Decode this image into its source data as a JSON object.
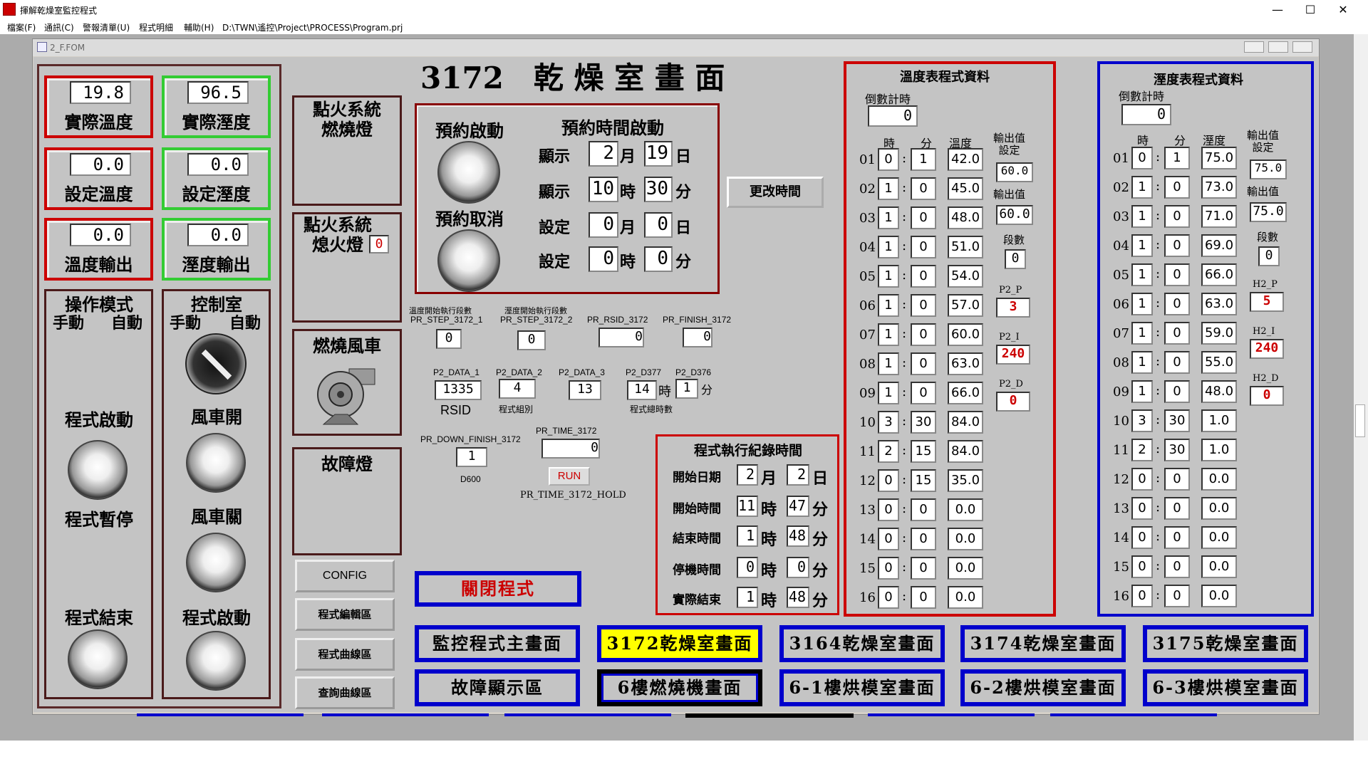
{
  "window": {
    "title": "揮解乾燥室監控程式",
    "min": "—",
    "max": "☐",
    "close": "✕"
  },
  "menu": [
    "檔案(F)",
    "通訊(C)",
    "警報清單(U)",
    "程式明細",
    "輔助(H)",
    "D:\\TWN\\遙控\\Project\\PROCESS\\Program.prj"
  ],
  "child": {
    "title": "2_F.FOM"
  },
  "page_title": "3172　乾 燥 室 畫 面",
  "readouts": [
    {
      "value": "19.8",
      "label": "實際溫度",
      "color": "red"
    },
    {
      "value": "96.5",
      "label": "實際溼度",
      "color": "green"
    },
    {
      "value": "0.0",
      "label": "設定溫度",
      "color": "red"
    },
    {
      "value": "0.0",
      "label": "設定溼度",
      "color": "green"
    },
    {
      "value": "0.0",
      "label": "溫度輸出",
      "color": "red"
    },
    {
      "value": "0.0",
      "label": "溼度輸出",
      "color": "green"
    }
  ],
  "mode_panel": {
    "title": "操作模式",
    "manual": "手動",
    "auto": "自動",
    "start": "程式啟動",
    "pause": "程式暫停",
    "end": "程式結束"
  },
  "control_panel": {
    "title": "控制室",
    "manual": "手動",
    "auto": "自動",
    "fan_on": "風車開",
    "fan_off": "風車關",
    "start": "程式啟動"
  },
  "ignition_burn": "點火系統\n燃燒燈",
  "ignition_off": {
    "label": "點火系統\n熄火燈",
    "value": "0"
  },
  "burner_fan": "燃燒風車",
  "fault_lamp": "故障燈",
  "config": "CONFIG",
  "prog_edit": "程式編輯區",
  "prog_curve": "程式曲線區",
  "query_curve": "查詢曲線區",
  "schedule": {
    "start_label": "預約啟動",
    "cancel_label": "預約取消",
    "title": "預約時間啟動",
    "rows": [
      {
        "prefix": "顯示",
        "a": "2",
        "ua": "月",
        "b": "19",
        "ub": "日"
      },
      {
        "prefix": "顯示",
        "a": "10",
        "ua": "時",
        "b": "30",
        "ub": "分"
      },
      {
        "prefix": "設定",
        "a": "0",
        "ua": "月",
        "b": "0",
        "ub": "日"
      },
      {
        "prefix": "設定",
        "a": "0",
        "ua": "時",
        "b": "0",
        "ub": "分"
      }
    ]
  },
  "change_time": "更改時間",
  "vars": {
    "step1_cn": "溫度開始執行段數",
    "step1": "PR_STEP_3172_1",
    "step1_v": "0",
    "step2_cn": "溼度開始執行段數",
    "step2": "PR_STEP_3172_2",
    "step2_v": "0",
    "rsid": "PR_RSID_3172",
    "rsid_v": "0",
    "finish": "PR_FINISH_3172",
    "finish_v": "0",
    "d1": "P2_DATA_1",
    "d1_v": "1335",
    "d1_sub": "RSID",
    "d2": "P2_DATA_2",
    "d2_v": "4",
    "d2_sub": "程式組別",
    "d3": "P2_DATA_3",
    "d3_v": "13",
    "d377": "P2_D377",
    "d377_v": "14",
    "d377_u": "時",
    "d376": "P2_D376",
    "d376_v": "1",
    "d376_u": "分",
    "total": "程式總時數",
    "down": "PR_DOWN_FINISH_3172",
    "down_v": "1",
    "down_sub": "D600",
    "time": "PR_TIME_3172",
    "time_v": "0",
    "run": "RUN",
    "hold": "PR_TIME_3172_HOLD"
  },
  "log": {
    "title": "程式執行紀錄時間",
    "rows": [
      {
        "label": "開始日期",
        "a": "2",
        "ua": "月",
        "b": "2",
        "ub": "日"
      },
      {
        "label": "開始時間",
        "a": "11",
        "ua": "時",
        "b": "47",
        "ub": "分"
      },
      {
        "label": "結束時間",
        "a": "1",
        "ua": "時",
        "b": "48",
        "ub": "分"
      },
      {
        "label": "停機時間",
        "a": "0",
        "ua": "時",
        "b": "0",
        "ub": "分"
      },
      {
        "label": "實際結束",
        "a": "1",
        "ua": "時",
        "b": "48",
        "ub": "分"
      }
    ]
  },
  "close_prog": "關閉程式",
  "temp_table": {
    "title": "溫度表程式資料",
    "countdown": "倒數計時",
    "countdown_v": "0",
    "h_hour": "時",
    "h_min": "分",
    "h_val": "溫度",
    "out_set": "輸出值\n設定",
    "out_set_v": "60.0",
    "out": "輸出值",
    "out_v": "60.0",
    "seg": "段數",
    "seg_v": "0",
    "p": "P2_P",
    "p_v": "3",
    "i": "P2_I",
    "i_v": "240",
    "d": "P2_D",
    "d_v": "0",
    "rows": [
      [
        "01",
        "0",
        "1",
        "42.0"
      ],
      [
        "02",
        "1",
        "0",
        "45.0"
      ],
      [
        "03",
        "1",
        "0",
        "48.0"
      ],
      [
        "04",
        "1",
        "0",
        "51.0"
      ],
      [
        "05",
        "1",
        "0",
        "54.0"
      ],
      [
        "06",
        "1",
        "0",
        "57.0"
      ],
      [
        "07",
        "1",
        "0",
        "60.0"
      ],
      [
        "08",
        "1",
        "0",
        "63.0"
      ],
      [
        "09",
        "1",
        "0",
        "66.0"
      ],
      [
        "10",
        "3",
        "30",
        "84.0"
      ],
      [
        "11",
        "2",
        "15",
        "84.0"
      ],
      [
        "12",
        "0",
        "15",
        "35.0"
      ],
      [
        "13",
        "0",
        "0",
        "0.0"
      ],
      [
        "14",
        "0",
        "0",
        "0.0"
      ],
      [
        "15",
        "0",
        "0",
        "0.0"
      ],
      [
        "16",
        "0",
        "0",
        "0.0"
      ]
    ]
  },
  "hum_table": {
    "title": "溼度表程式資料",
    "countdown": "倒數計時",
    "countdown_v": "0",
    "h_hour": "時",
    "h_min": "分",
    "h_val": "溼度",
    "out_set": "輸出值\n設定",
    "out_set_v": "75.0",
    "out": "輸出值",
    "out_v": "75.0",
    "seg": "段數",
    "seg_v": "0",
    "p": "H2_P",
    "p_v": "5",
    "i": "H2_I",
    "i_v": "240",
    "d": "H2_D",
    "d_v": "0",
    "rows": [
      [
        "01",
        "0",
        "1",
        "75.0"
      ],
      [
        "02",
        "1",
        "0",
        "73.0"
      ],
      [
        "03",
        "1",
        "0",
        "71.0"
      ],
      [
        "04",
        "1",
        "0",
        "69.0"
      ],
      [
        "05",
        "1",
        "0",
        "66.0"
      ],
      [
        "06",
        "1",
        "0",
        "63.0"
      ],
      [
        "07",
        "1",
        "0",
        "59.0"
      ],
      [
        "08",
        "1",
        "0",
        "55.0"
      ],
      [
        "09",
        "1",
        "0",
        "48.0"
      ],
      [
        "10",
        "3",
        "30",
        "1.0"
      ],
      [
        "11",
        "2",
        "30",
        "1.0"
      ],
      [
        "12",
        "0",
        "0",
        "0.0"
      ],
      [
        "13",
        "0",
        "0",
        "0.0"
      ],
      [
        "14",
        "0",
        "0",
        "0.0"
      ],
      [
        "15",
        "0",
        "0",
        "0.0"
      ],
      [
        "16",
        "0",
        "0",
        "0.0"
      ]
    ]
  },
  "nav": [
    {
      "label": "監控程式主畫面",
      "active": false
    },
    {
      "label": "3172乾燥室畫面",
      "active": true
    },
    {
      "label": "3164乾燥室畫面",
      "active": false
    },
    {
      "label": "3174乾燥室畫面",
      "active": false
    },
    {
      "label": "3175乾燥室畫面",
      "active": false
    },
    {
      "label": "故障顯示區",
      "active": false
    },
    {
      "label": "6樓燃燒機畫面",
      "active": false
    },
    {
      "label": "6-1樓烘模室畫面",
      "active": false
    },
    {
      "label": "6-2樓烘模室畫面",
      "active": false
    },
    {
      "label": "6-3樓烘模室畫面",
      "active": false
    }
  ],
  "colors": {
    "red": "#cc0000",
    "green": "#33cc33",
    "blue": "#0000cc",
    "active_nav": "#ffff00"
  }
}
